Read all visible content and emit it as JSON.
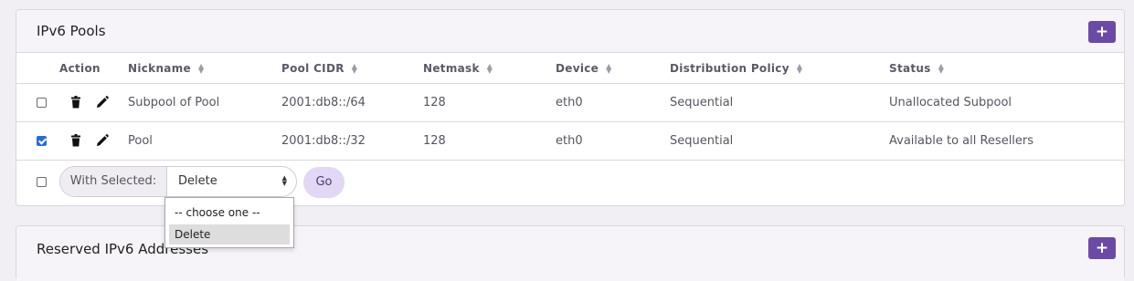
{
  "pools_panel": {
    "title": "IPv6 Pools",
    "add_label": "+",
    "columns": [
      "Action",
      "Nickname",
      "Pool CIDR",
      "Netmask",
      "Device",
      "Distribution Policy",
      "Status"
    ],
    "rows": [
      {
        "checked": false,
        "nickname": "Subpool of Pool",
        "pool_cidr": "2001:db8::/64",
        "netmask": "128",
        "device": "eth0",
        "distribution_policy": "Sequential",
        "status": "Unallocated Subpool"
      },
      {
        "checked": true,
        "nickname": "Pool",
        "pool_cidr": "2001:db8::/32",
        "netmask": "128",
        "device": "eth0",
        "distribution_policy": "Sequential",
        "status": "Available to all Resellers"
      }
    ],
    "bulk": {
      "with_selected_label": "With Selected:",
      "selected_value": "Delete",
      "go_label": "Go",
      "options": [
        "-- choose one --",
        "Delete"
      ],
      "highlighted_option": "Delete"
    }
  },
  "reserved_panel": {
    "title": "Reserved IPv6 Addresses",
    "add_label": "+"
  },
  "colors": {
    "accent": "#6b4aa6",
    "go_button_bg": "#e2d7f4",
    "checkbox_checked": "#2a6ad8"
  },
  "icons": [
    "trash-icon",
    "pencil-icon",
    "sort-icon",
    "plus-icon"
  ]
}
